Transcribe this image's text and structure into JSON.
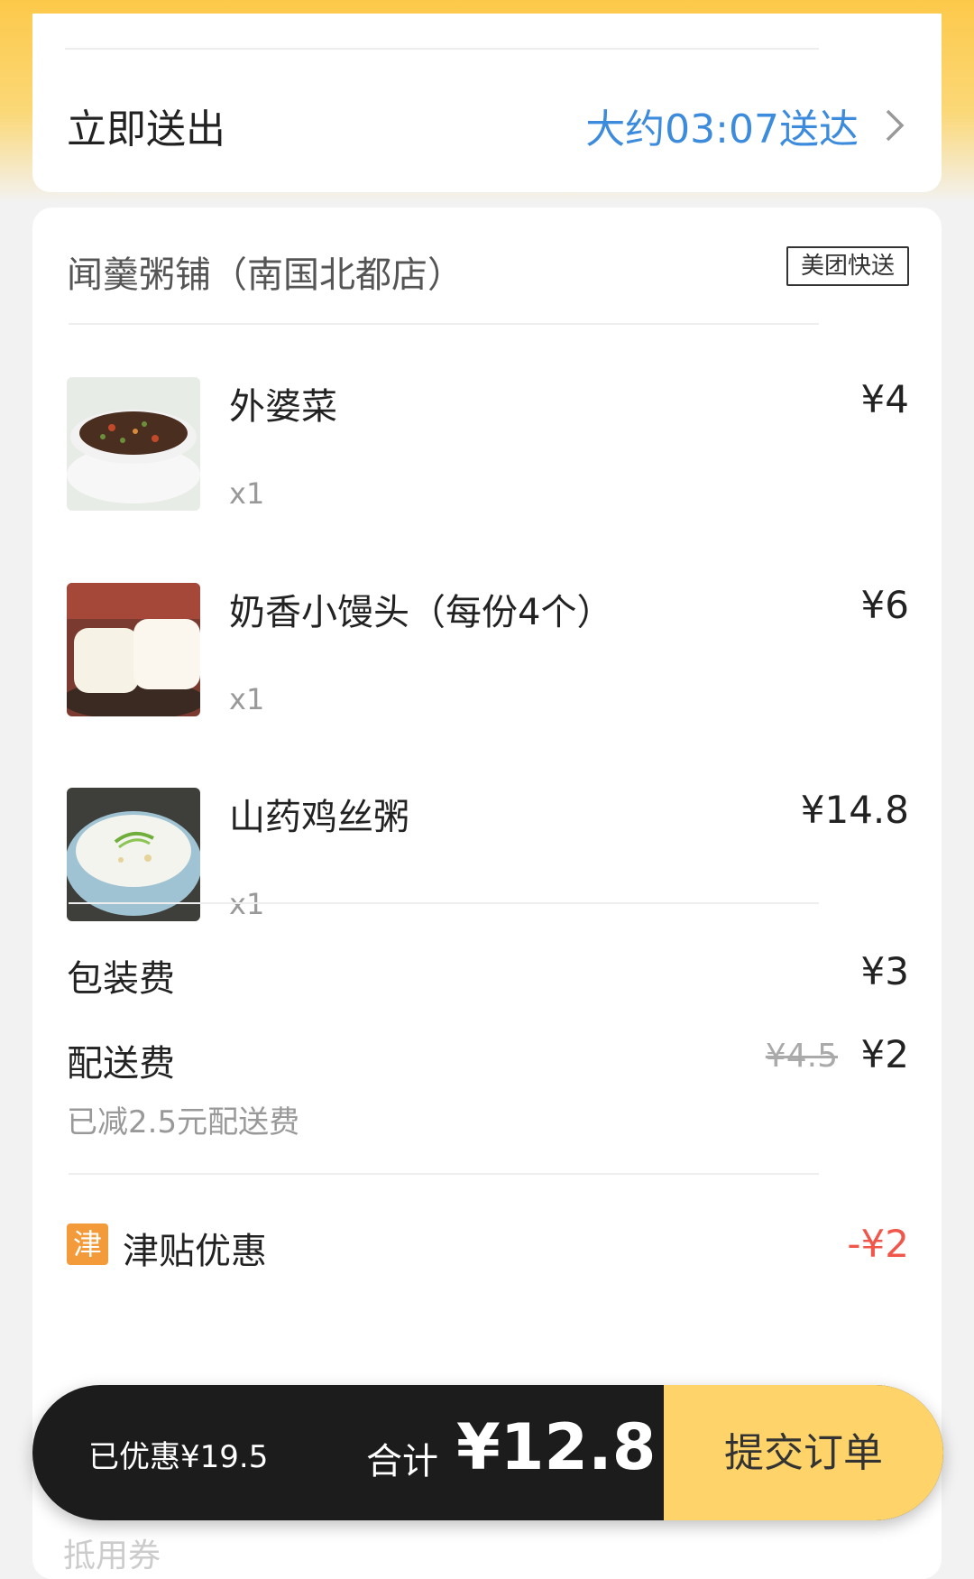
{
  "delivery": {
    "label": "立即送出",
    "eta": "大约03:07送达",
    "chevron_icon": "chevron-right-icon"
  },
  "shop": {
    "name": "闻羹粥铺（南国北都店）",
    "tag": "美团快送"
  },
  "items": [
    {
      "name": "外婆菜",
      "qty": "x1",
      "price": "¥4",
      "image_icon": "minced-vegetable-dish-photo"
    },
    {
      "name": "奶香小馒头（每份4个）",
      "qty": "x1",
      "price": "¥6",
      "image_icon": "steamed-buns-photo"
    },
    {
      "name": "山药鸡丝粥",
      "qty": "x1",
      "price": "¥14.8",
      "image_icon": "congee-bowl-photo"
    }
  ],
  "fees": {
    "packaging_label": "包装费",
    "packaging_price": "¥3",
    "delivery_label": "配送费",
    "delivery_old_price": "¥4.5",
    "delivery_price": "¥2",
    "delivery_note": "已减2.5元配送费"
  },
  "promo": {
    "icon_text": "津",
    "label": "津贴优惠",
    "value": "-¥2"
  },
  "checkout": {
    "saved": "已优惠¥19.5",
    "total_label": "合计",
    "total_value": "¥12.8",
    "submit": "提交订单"
  },
  "faded": {
    "text": "抵用券"
  },
  "colors": {
    "accent_blue": "#3d8bdc",
    "brand_yellow": "#fdd36a",
    "discount_red": "#f0564a",
    "promo_orange": "#f39a3a"
  }
}
